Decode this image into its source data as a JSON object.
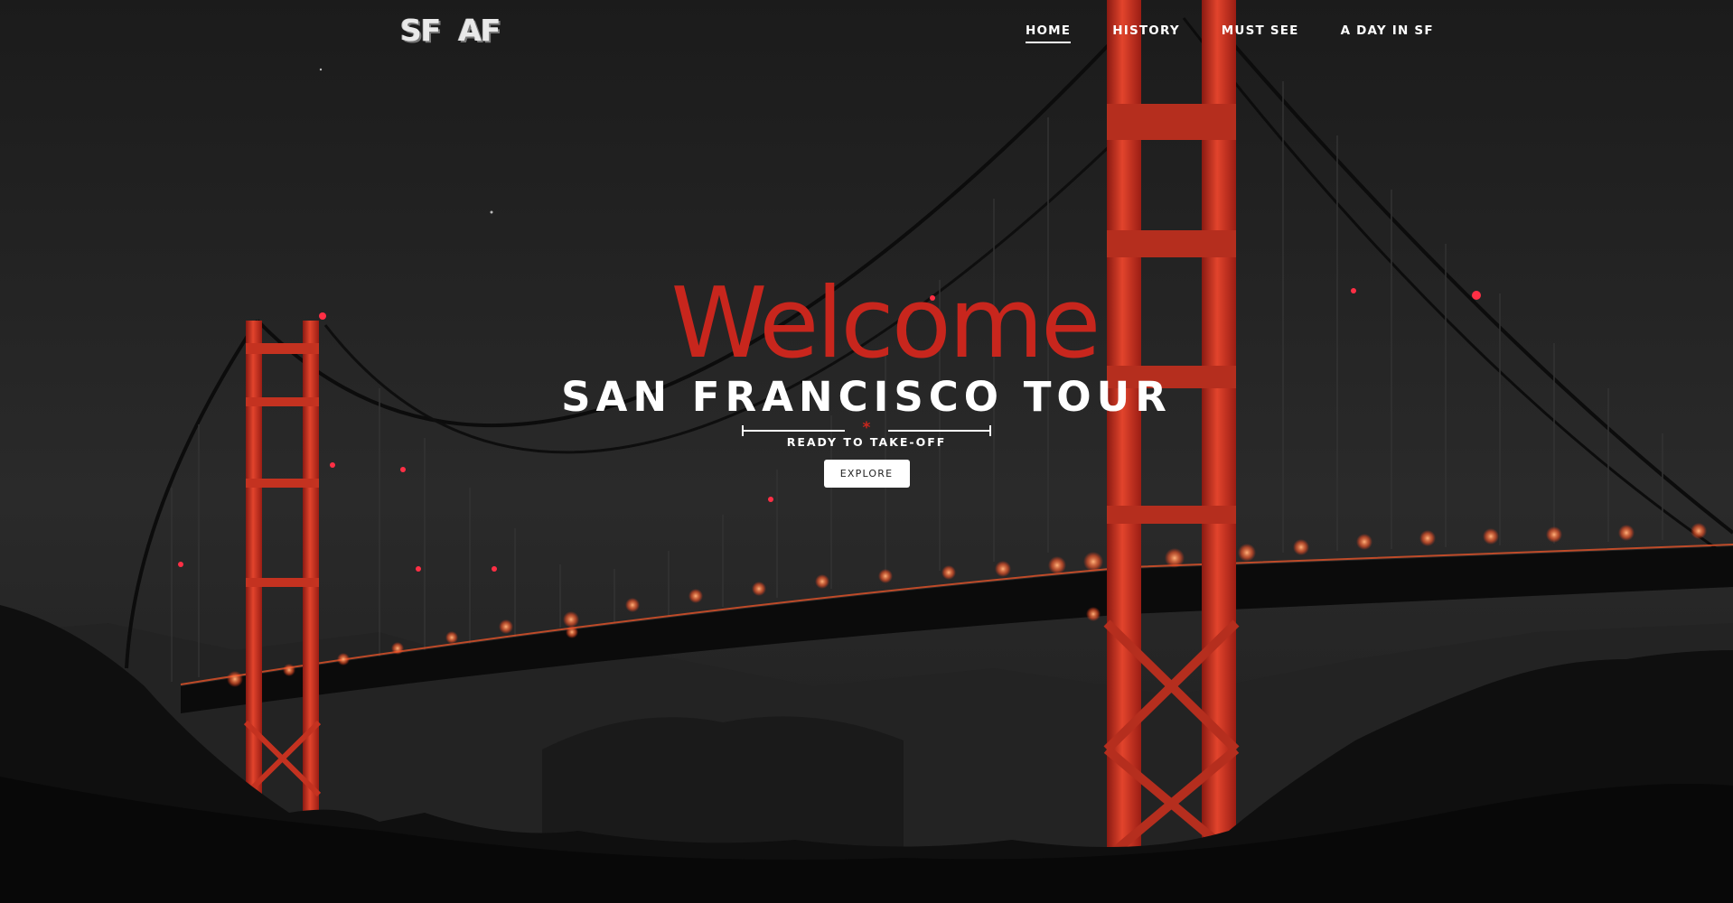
{
  "brand": {
    "logo_text_left": "SF",
    "logo_text_right": "AF"
  },
  "nav": {
    "items": [
      {
        "label": "HOME",
        "active": true
      },
      {
        "label": "HISTORY",
        "active": false
      },
      {
        "label": "MUST SEE",
        "active": false
      },
      {
        "label": "A DAY IN SF",
        "active": false
      }
    ]
  },
  "hero": {
    "welcome": "Welcome",
    "title": "SAN FRANCISCO TOUR",
    "divider_symbol": "*",
    "tagline": "READY TO TAKE-OFF",
    "button_label": "EXPLORE",
    "background_image": "Golden Gate Bridge at night, red towers on black-and-white scene"
  },
  "colors": {
    "accent_red": "#c8261d",
    "text_white": "#ffffff",
    "background_dark": "#1a1a1a"
  }
}
